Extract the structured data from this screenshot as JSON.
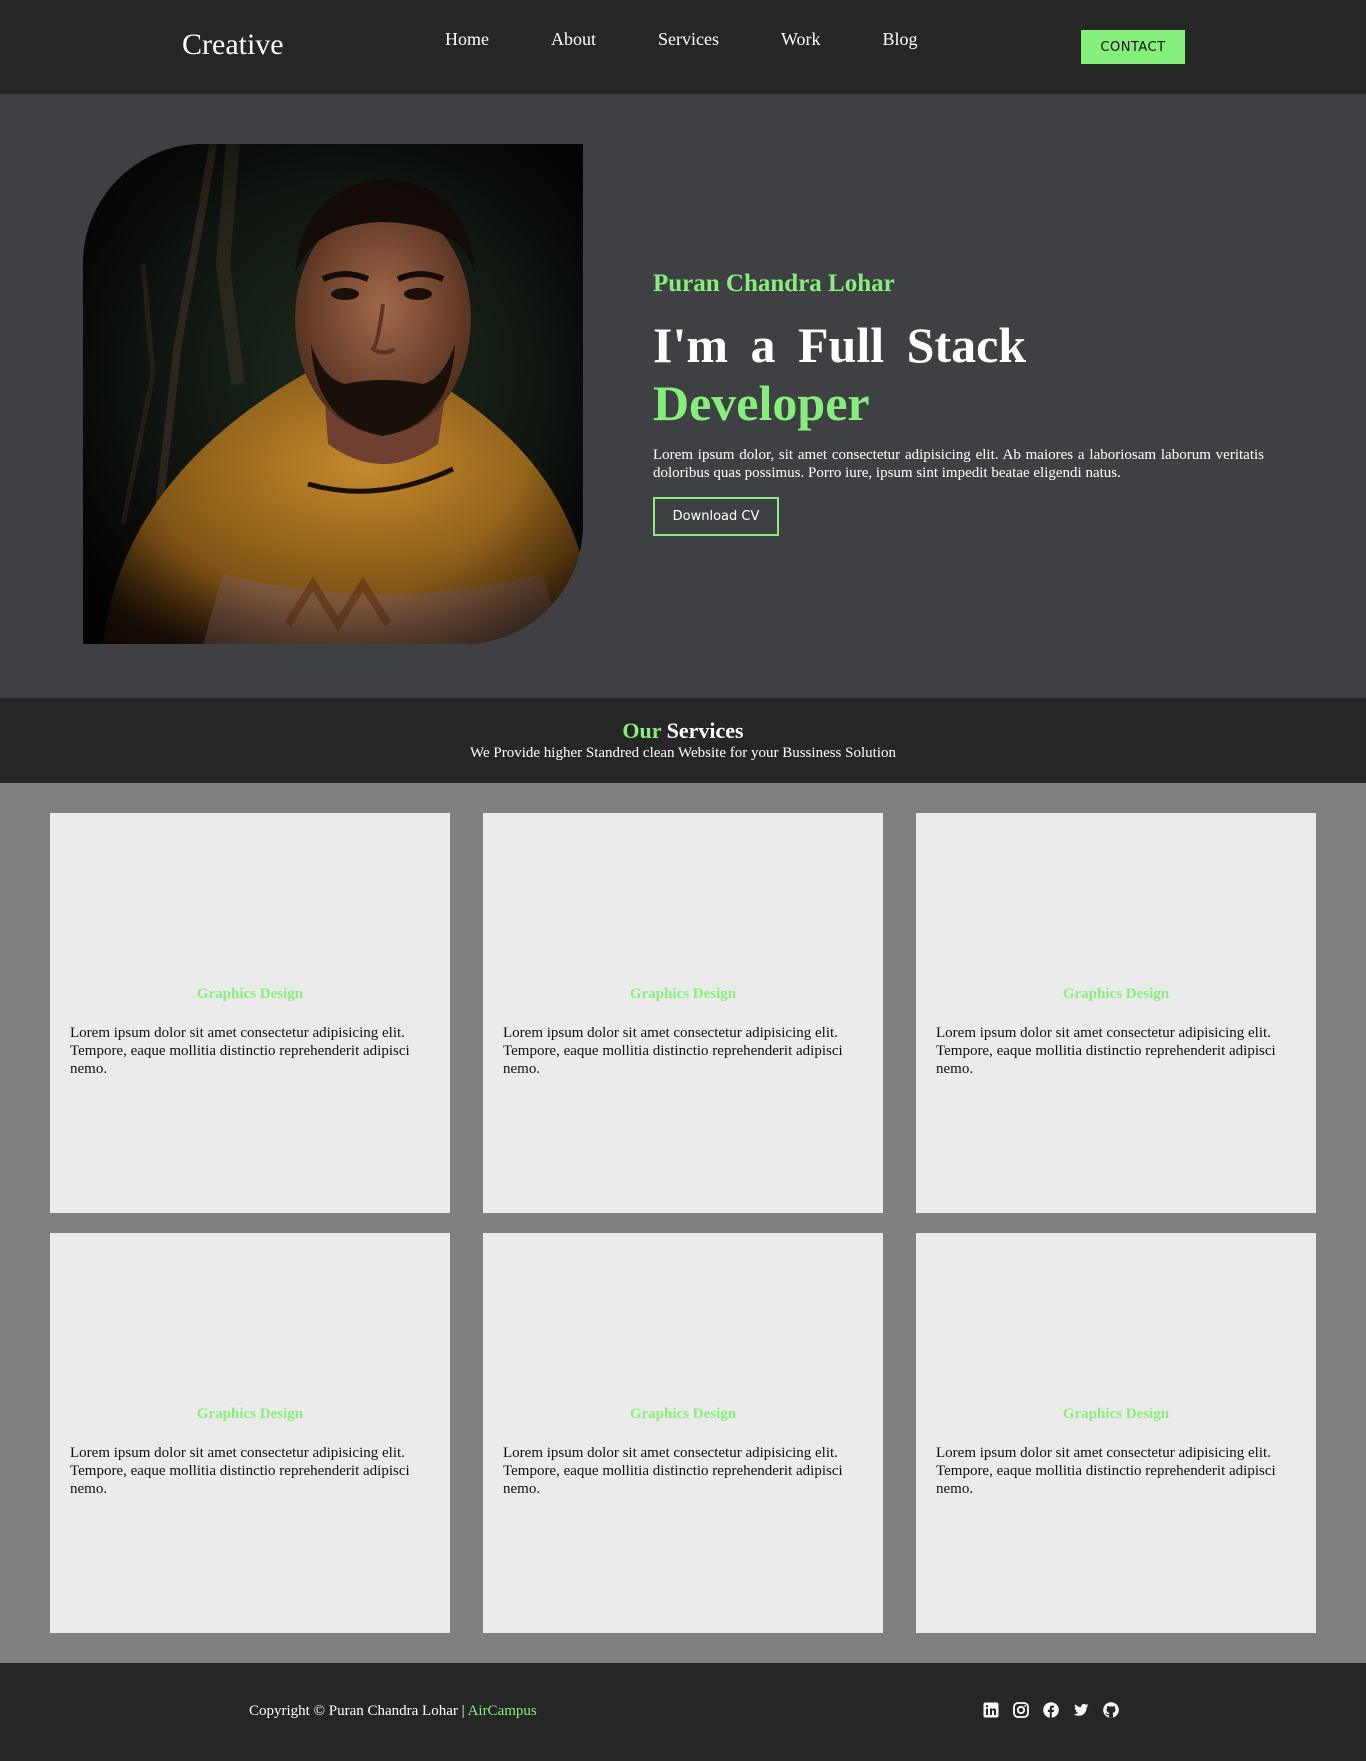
{
  "nav": {
    "logo": "Creative",
    "items": [
      {
        "label": "Home"
      },
      {
        "label": "About"
      },
      {
        "label": "Services"
      },
      {
        "label": "Work"
      },
      {
        "label": "Blog"
      }
    ],
    "contact_label": "CONTACT"
  },
  "hero": {
    "name": "Puran Chandra Lohar",
    "title_line1": "I'm a Full Stack",
    "title_line2": "Developer",
    "description": "Lorem ipsum dolor, sit amet consectetur adipisicing elit. Ab maiores a laboriosam laborum veritatis doloribus quas possimus. Porro iure, ipsum sint impedit beatae eligendi natus.",
    "cv_label": "Download CV"
  },
  "services": {
    "title_highlight": "Our",
    "title_rest": "Services",
    "subtitle": "We Provide higher Standred clean Website for your Bussiness Solution",
    "cards": [
      {
        "title": "Graphics Design",
        "text": "Lorem ipsum dolor sit amet consectetur adipisicing elit. Tempore, eaque mollitia distinctio reprehenderit adipisci nemo."
      },
      {
        "title": "Graphics Design",
        "text": "Lorem ipsum dolor sit amet consectetur adipisicing elit. Tempore, eaque mollitia distinctio reprehenderit adipisci nemo."
      },
      {
        "title": "Graphics Design",
        "text": "Lorem ipsum dolor sit amet consectetur adipisicing elit. Tempore, eaque mollitia distinctio reprehenderit adipisci nemo."
      },
      {
        "title": "Graphics Design",
        "text": "Lorem ipsum dolor sit amet consectetur adipisicing elit. Tempore, eaque mollitia distinctio reprehenderit adipisci nemo."
      },
      {
        "title": "Graphics Design",
        "text": "Lorem ipsum dolor sit amet consectetur adipisicing elit. Tempore, eaque mollitia distinctio reprehenderit adipisci nemo."
      },
      {
        "title": "Graphics Design",
        "text": "Lorem ipsum dolor sit amet consectetur adipisicing elit. Tempore, eaque mollitia distinctio reprehenderit adipisci nemo."
      }
    ]
  },
  "footer": {
    "copyright": "Copyright © Puran Chandra Lohar |",
    "brand": "AirCampus",
    "socials": [
      "linkedin-icon",
      "instagram-icon",
      "facebook-icon",
      "twitter-icon",
      "github-icon"
    ]
  },
  "colors": {
    "accent": "#86ee7b",
    "dark": "#262626",
    "hero_bg": "#3f4043",
    "cards_bg": "#808080",
    "card": "#ebebeb"
  }
}
